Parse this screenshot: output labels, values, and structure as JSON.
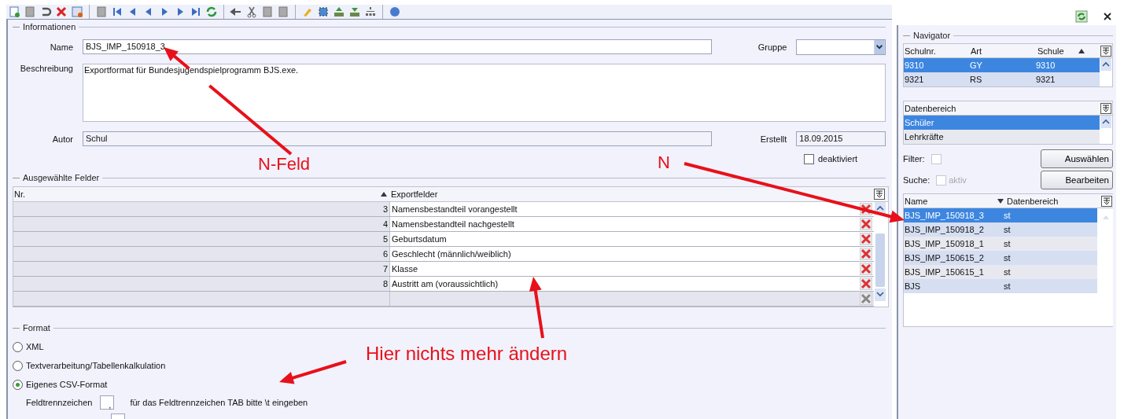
{
  "info": {
    "legend": "Informationen",
    "name_label": "Name",
    "name_value": "BJS_IMP_150918_3",
    "gruppe_label": "Gruppe",
    "beschreibung_label": "Beschreibung",
    "beschreibung_value": "Exportformat für Bundesjugendspielprogramm BJS.exe.",
    "autor_label": "Autor",
    "autor_value": "Schul",
    "erstellt_label": "Erstellt",
    "erstellt_value": "18.09.2015",
    "deaktiviert": {
      "label": "deaktiviert",
      "checked": false
    }
  },
  "fields_table": {
    "legend": "Ausgewählte Felder",
    "columns": [
      "Nr.",
      "Exportfelder"
    ],
    "rows": [
      {
        "nr": "3",
        "field": "Namensbestandteil vorangestellt"
      },
      {
        "nr": "4",
        "field": "Namensbestandteil nachgestellt"
      },
      {
        "nr": "5",
        "field": "Geburtsdatum"
      },
      {
        "nr": "6",
        "field": "Geschlecht (männlich/weiblich)"
      },
      {
        "nr": "7",
        "field": "Klasse"
      },
      {
        "nr": "8",
        "field": "Austritt am (voraussichtlich)"
      }
    ]
  },
  "format": {
    "legend": "Format",
    "options": [
      {
        "label": "XML",
        "selected": false
      },
      {
        "label": "Textverarbeitung/Tabellenkalkulation",
        "selected": false
      },
      {
        "label": "Eigenes CSV-Format",
        "selected": true
      }
    ],
    "separator": {
      "label": "Feldtrennzeichen",
      "value": ",",
      "hint": "für das Feldtrennzeichen TAB bitte \\t eingeben"
    }
  },
  "navigator": {
    "legend": "Navigator",
    "schools": {
      "columns": [
        "Schulnr.",
        "Art",
        "Schule"
      ],
      "rows": [
        {
          "cells": [
            "9310",
            "GY",
            "9310"
          ],
          "selected": true
        },
        {
          "cells": [
            "9321",
            "RS",
            "9321"
          ],
          "selected": false
        }
      ]
    },
    "areas": {
      "header": "Datenbereich",
      "items": [
        {
          "label": "Schüler",
          "selected": true
        },
        {
          "label": "Lehrkräfte",
          "selected": false
        }
      ]
    },
    "filter": {
      "label": "Filter:",
      "checked": false
    },
    "search": {
      "label": "Suche:",
      "checkbox_label": "aktiv",
      "checked": false,
      "disabled": true
    },
    "buttons": [
      "Auswählen",
      "Bearbeiten"
    ],
    "exports": {
      "columns": [
        "Name",
        "Datenbereich"
      ],
      "rows": [
        {
          "cells": [
            "BJS_IMP_150918_3",
            "st"
          ],
          "selected": true
        },
        {
          "cells": [
            "BJS_IMP_150918_2",
            "st"
          ],
          "selected": false
        },
        {
          "cells": [
            "BJS_IMP_150918_1",
            "st"
          ],
          "selected": false
        },
        {
          "cells": [
            "BJS_IMP_150615_2",
            "st"
          ],
          "selected": false
        },
        {
          "cells": [
            "BJS_IMP_150615_1",
            "st"
          ],
          "selected": false
        },
        {
          "cells": [
            "BJS",
            "st"
          ],
          "selected": false
        }
      ]
    }
  },
  "annotations": [
    {
      "text": "N-Feld"
    },
    {
      "text": "N"
    },
    {
      "text": "Hier nichts mehr ändern"
    }
  ]
}
